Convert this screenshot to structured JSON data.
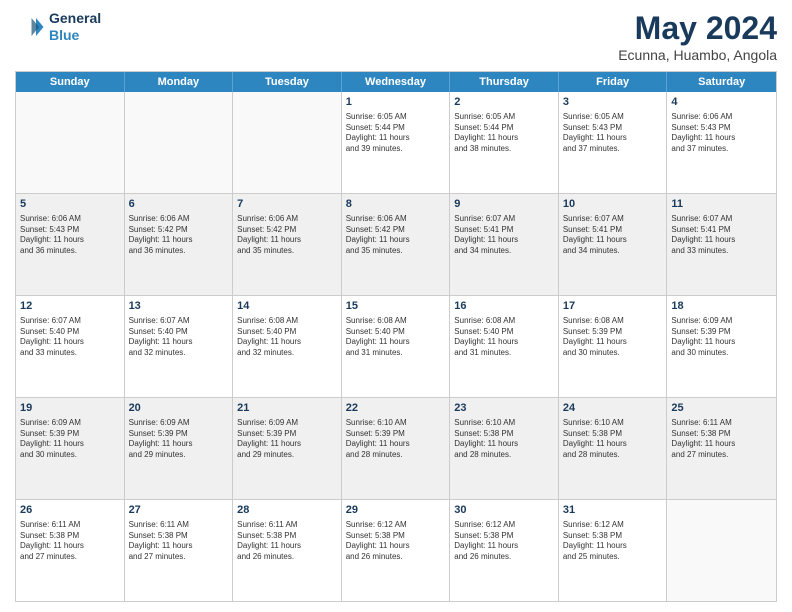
{
  "header": {
    "logo_line1": "General",
    "logo_line2": "Blue",
    "title": "May 2024",
    "subtitle": "Ecunna, Huambo, Angola"
  },
  "days": [
    "Sunday",
    "Monday",
    "Tuesday",
    "Wednesday",
    "Thursday",
    "Friday",
    "Saturday"
  ],
  "rows": [
    [
      {
        "day": "",
        "lines": []
      },
      {
        "day": "",
        "lines": []
      },
      {
        "day": "",
        "lines": []
      },
      {
        "day": "1",
        "lines": [
          "Sunrise: 6:05 AM",
          "Sunset: 5:44 PM",
          "Daylight: 11 hours",
          "and 39 minutes."
        ]
      },
      {
        "day": "2",
        "lines": [
          "Sunrise: 6:05 AM",
          "Sunset: 5:44 PM",
          "Daylight: 11 hours",
          "and 38 minutes."
        ]
      },
      {
        "day": "3",
        "lines": [
          "Sunrise: 6:05 AM",
          "Sunset: 5:43 PM",
          "Daylight: 11 hours",
          "and 37 minutes."
        ]
      },
      {
        "day": "4",
        "lines": [
          "Sunrise: 6:06 AM",
          "Sunset: 5:43 PM",
          "Daylight: 11 hours",
          "and 37 minutes."
        ]
      }
    ],
    [
      {
        "day": "5",
        "lines": [
          "Sunrise: 6:06 AM",
          "Sunset: 5:43 PM",
          "Daylight: 11 hours",
          "and 36 minutes."
        ]
      },
      {
        "day": "6",
        "lines": [
          "Sunrise: 6:06 AM",
          "Sunset: 5:42 PM",
          "Daylight: 11 hours",
          "and 36 minutes."
        ]
      },
      {
        "day": "7",
        "lines": [
          "Sunrise: 6:06 AM",
          "Sunset: 5:42 PM",
          "Daylight: 11 hours",
          "and 35 minutes."
        ]
      },
      {
        "day": "8",
        "lines": [
          "Sunrise: 6:06 AM",
          "Sunset: 5:42 PM",
          "Daylight: 11 hours",
          "and 35 minutes."
        ]
      },
      {
        "day": "9",
        "lines": [
          "Sunrise: 6:07 AM",
          "Sunset: 5:41 PM",
          "Daylight: 11 hours",
          "and 34 minutes."
        ]
      },
      {
        "day": "10",
        "lines": [
          "Sunrise: 6:07 AM",
          "Sunset: 5:41 PM",
          "Daylight: 11 hours",
          "and 34 minutes."
        ]
      },
      {
        "day": "11",
        "lines": [
          "Sunrise: 6:07 AM",
          "Sunset: 5:41 PM",
          "Daylight: 11 hours",
          "and 33 minutes."
        ]
      }
    ],
    [
      {
        "day": "12",
        "lines": [
          "Sunrise: 6:07 AM",
          "Sunset: 5:40 PM",
          "Daylight: 11 hours",
          "and 33 minutes."
        ]
      },
      {
        "day": "13",
        "lines": [
          "Sunrise: 6:07 AM",
          "Sunset: 5:40 PM",
          "Daylight: 11 hours",
          "and 32 minutes."
        ]
      },
      {
        "day": "14",
        "lines": [
          "Sunrise: 6:08 AM",
          "Sunset: 5:40 PM",
          "Daylight: 11 hours",
          "and 32 minutes."
        ]
      },
      {
        "day": "15",
        "lines": [
          "Sunrise: 6:08 AM",
          "Sunset: 5:40 PM",
          "Daylight: 11 hours",
          "and 31 minutes."
        ]
      },
      {
        "day": "16",
        "lines": [
          "Sunrise: 6:08 AM",
          "Sunset: 5:40 PM",
          "Daylight: 11 hours",
          "and 31 minutes."
        ]
      },
      {
        "day": "17",
        "lines": [
          "Sunrise: 6:08 AM",
          "Sunset: 5:39 PM",
          "Daylight: 11 hours",
          "and 30 minutes."
        ]
      },
      {
        "day": "18",
        "lines": [
          "Sunrise: 6:09 AM",
          "Sunset: 5:39 PM",
          "Daylight: 11 hours",
          "and 30 minutes."
        ]
      }
    ],
    [
      {
        "day": "19",
        "lines": [
          "Sunrise: 6:09 AM",
          "Sunset: 5:39 PM",
          "Daylight: 11 hours",
          "and 30 minutes."
        ]
      },
      {
        "day": "20",
        "lines": [
          "Sunrise: 6:09 AM",
          "Sunset: 5:39 PM",
          "Daylight: 11 hours",
          "and 29 minutes."
        ]
      },
      {
        "day": "21",
        "lines": [
          "Sunrise: 6:09 AM",
          "Sunset: 5:39 PM",
          "Daylight: 11 hours",
          "and 29 minutes."
        ]
      },
      {
        "day": "22",
        "lines": [
          "Sunrise: 6:10 AM",
          "Sunset: 5:39 PM",
          "Daylight: 11 hours",
          "and 28 minutes."
        ]
      },
      {
        "day": "23",
        "lines": [
          "Sunrise: 6:10 AM",
          "Sunset: 5:38 PM",
          "Daylight: 11 hours",
          "and 28 minutes."
        ]
      },
      {
        "day": "24",
        "lines": [
          "Sunrise: 6:10 AM",
          "Sunset: 5:38 PM",
          "Daylight: 11 hours",
          "and 28 minutes."
        ]
      },
      {
        "day": "25",
        "lines": [
          "Sunrise: 6:11 AM",
          "Sunset: 5:38 PM",
          "Daylight: 11 hours",
          "and 27 minutes."
        ]
      }
    ],
    [
      {
        "day": "26",
        "lines": [
          "Sunrise: 6:11 AM",
          "Sunset: 5:38 PM",
          "Daylight: 11 hours",
          "and 27 minutes."
        ]
      },
      {
        "day": "27",
        "lines": [
          "Sunrise: 6:11 AM",
          "Sunset: 5:38 PM",
          "Daylight: 11 hours",
          "and 27 minutes."
        ]
      },
      {
        "day": "28",
        "lines": [
          "Sunrise: 6:11 AM",
          "Sunset: 5:38 PM",
          "Daylight: 11 hours",
          "and 26 minutes."
        ]
      },
      {
        "day": "29",
        "lines": [
          "Sunrise: 6:12 AM",
          "Sunset: 5:38 PM",
          "Daylight: 11 hours",
          "and 26 minutes."
        ]
      },
      {
        "day": "30",
        "lines": [
          "Sunrise: 6:12 AM",
          "Sunset: 5:38 PM",
          "Daylight: 11 hours",
          "and 26 minutes."
        ]
      },
      {
        "day": "31",
        "lines": [
          "Sunrise: 6:12 AM",
          "Sunset: 5:38 PM",
          "Daylight: 11 hours",
          "and 25 minutes."
        ]
      },
      {
        "day": "",
        "lines": []
      }
    ]
  ]
}
